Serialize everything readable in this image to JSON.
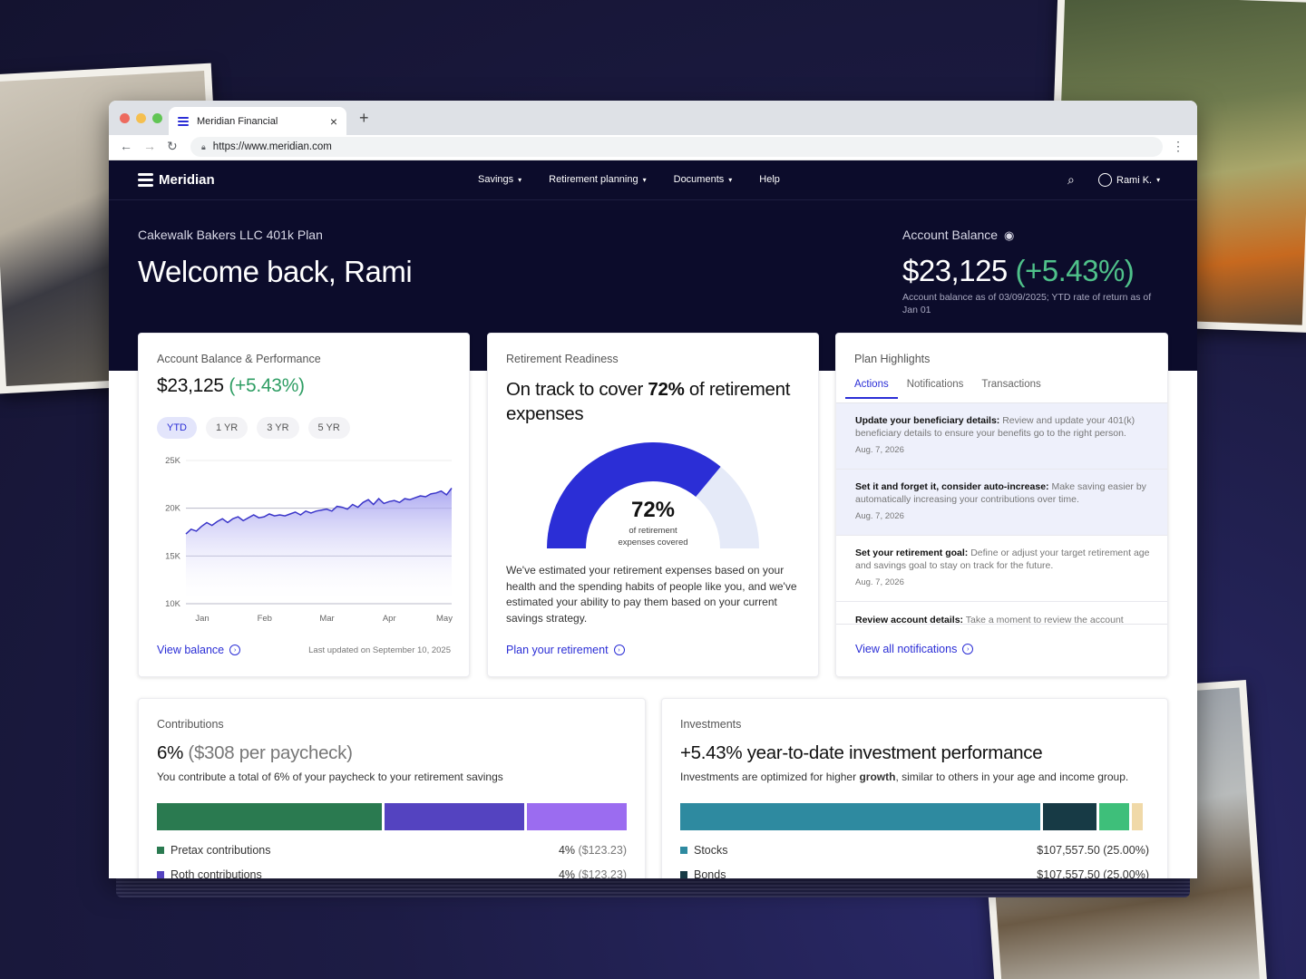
{
  "browser": {
    "tab_title": "Meridian Financial",
    "tab_close": "×",
    "new_tab": "+",
    "url": "https://www.meridian.com",
    "dot_colors": [
      "#ed6a5e",
      "#f5bf4f",
      "#61c554"
    ]
  },
  "nav": {
    "brand": "Meridian",
    "items": [
      {
        "label": "Savings",
        "dropdown": true
      },
      {
        "label": "Retirement planning",
        "dropdown": true
      },
      {
        "label": "Documents",
        "dropdown": true
      },
      {
        "label": "Help",
        "dropdown": false
      }
    ],
    "user": "Rami K."
  },
  "hero": {
    "plan": "Cakewalk Bakers LLC 401k Plan",
    "welcome": "Welcome back, Rami",
    "balance_label": "Account Balance",
    "balance": "$23,125",
    "balance_change": "(+5.43%)",
    "balance_note": "Account balance as of 03/09/2025; YTD rate of return as of Jan 01"
  },
  "performance": {
    "title": "Account Balance & Performance",
    "value": "$23,125",
    "change": "(+5.43%)",
    "ranges": [
      "YTD",
      "1 YR",
      "3 YR",
      "5 YR"
    ],
    "active_range": "YTD",
    "link": "View balance",
    "updated": "Last updated on September 10, 2025"
  },
  "chart_data": {
    "type": "area",
    "x_ticks": [
      "Jan",
      "Feb",
      "Mar",
      "Apr",
      "May"
    ],
    "y_ticks": [
      "25K",
      "20K",
      "15K",
      "10K"
    ],
    "ylim": [
      10000,
      25000
    ],
    "values": [
      17300,
      17800,
      17600,
      18100,
      18500,
      18200,
      18600,
      18900,
      18500,
      18900,
      19100,
      18700,
      19000,
      19300,
      19000,
      19100,
      19400,
      19200,
      19300,
      19200,
      19400,
      19600,
      19300,
      19700,
      19500,
      19700,
      19800,
      19900,
      19700,
      20200,
      20100,
      19900,
      20400,
      20100,
      20600,
      20900,
      20400,
      21000,
      20500,
      20700,
      20800,
      20600,
      21000,
      20900,
      21100,
      21300,
      21200,
      21500,
      21600,
      21800,
      21400,
      22100
    ]
  },
  "readiness": {
    "title": "Retirement Readiness",
    "headline_pre": "On track to cover ",
    "headline_pct": "72%",
    "headline_post": " of retirement expenses",
    "gauge_value": 72,
    "gauge_label": "72%",
    "gauge_caption_1": "of retirement",
    "gauge_caption_2": "expenses covered",
    "body": "We've estimated your retirement expenses based on your health and the spending habits of people like you, and we've estimated your ability to pay them based on your current savings strategy.",
    "link": "Plan your retirement"
  },
  "highlights": {
    "title": "Plan Highlights",
    "tabs": [
      "Actions",
      "Notifications",
      "Transactions"
    ],
    "active_tab": "Actions",
    "items": [
      {
        "title": "Update your beneficiary details:",
        "text": " Review and update your 401(k) beneficiary details to ensure your benefits go to the right person.",
        "date": "Aug. 7, 2026"
      },
      {
        "title": "Set it and forget it, consider auto-increase:",
        "text": " Make saving easier by automatically increasing your contributions over time.",
        "date": "Aug. 7, 2026"
      },
      {
        "title": "Set your retirement goal:",
        "text": " Define or adjust your target retirement age and savings goal to stay on track for the future.",
        "date": "Aug. 7, 2026"
      },
      {
        "title": "Review account details:",
        "text": " Take a moment to review the account",
        "date": ""
      }
    ],
    "link": "View all notifications"
  },
  "contributions": {
    "title": "Contributions",
    "headline_pct": "6%",
    "headline_detail": " ($308 per paycheck)",
    "sub": "You contribute a total of 6% of your paycheck to your retirement savings",
    "bar": [
      {
        "share": 0.485,
        "color": "#2a7a50"
      },
      {
        "share": 0.3,
        "color": "#5443c0"
      },
      {
        "share": 0.215,
        "color": "#9b6cf0"
      }
    ],
    "legend": [
      {
        "label": "Pretax contributions",
        "pct": "4%",
        "amount": " ($123.23)",
        "color": "#2a7a50"
      },
      {
        "label": "Roth contributions",
        "pct": "4%",
        "amount": " ($123.23)",
        "color": "#5443c0"
      }
    ]
  },
  "investments": {
    "title": "Investments",
    "headline_pct": "+5.43%",
    "headline_text": " year-to-date investment performance",
    "sub_pre": "Investments are optimized for higher ",
    "sub_bold": "growth",
    "sub_post": ", similar to others in your age and income group.",
    "bar": [
      {
        "share": 0.78,
        "color": "#2e8aa0"
      },
      {
        "share": 0.115,
        "color": "#173a45"
      },
      {
        "share": 0.065,
        "color": "#3ebf7a"
      },
      {
        "share": 0.025,
        "color": "#f0d9a8"
      }
    ],
    "legend": [
      {
        "label": "Stocks",
        "value": "$107,557.50 (25.00%)",
        "color": "#2e8aa0"
      },
      {
        "label": "Bonds",
        "value": "$107,557.50 (25.00%)",
        "color": "#173a45"
      }
    ]
  }
}
